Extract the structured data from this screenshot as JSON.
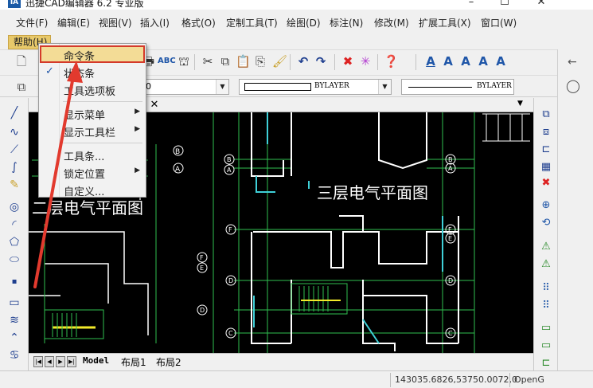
{
  "window": {
    "title": "迅捷CAD编辑器 6.2 专业版",
    "logo_text": "IA",
    "minimize_glyph": "–",
    "maximize_glyph": "☐",
    "close_glyph": "✕"
  },
  "menubar": {
    "items": [
      "文件(F)",
      "编辑(E)",
      "视图(V)",
      "插入(I)",
      "格式(O)",
      "定制工具(T)",
      "绘图(D)",
      "标注(N)",
      "修改(M)",
      "扩展工具(X)",
      "窗口(W)"
    ],
    "help_label": "帮助(H)"
  },
  "toolbar2": {
    "layer_value": "0",
    "linetype_value": "BYLAYER",
    "lineweight_value": "BYLAYER"
  },
  "help_menu": {
    "items": [
      {
        "label": "命令条",
        "checked": false,
        "submenu": false,
        "highlighted": true
      },
      {
        "label": "状态条",
        "checked": true,
        "submenu": false,
        "highlighted": false
      },
      {
        "label": "工具选项板",
        "checked": false,
        "submenu": false,
        "highlighted": false
      },
      {
        "label": "显示菜单",
        "checked": false,
        "submenu": true,
        "highlighted": false
      },
      {
        "label": "显示工具栏",
        "checked": false,
        "submenu": true,
        "highlighted": false
      },
      {
        "label": "工具条...",
        "checked": false,
        "submenu": false,
        "highlighted": false
      },
      {
        "label": "锁定位置",
        "checked": false,
        "submenu": true,
        "highlighted": false
      },
      {
        "label": "自定义...",
        "checked": false,
        "submenu": false,
        "highlighted": false
      }
    ],
    "check_glyph": "✓",
    "arrow_glyph": "▶"
  },
  "document": {
    "close_glyph": "✕"
  },
  "drawing": {
    "title_left": "二层电气平面图",
    "title_right": "三层电气平面图",
    "axis_labels_right": [
      "B",
      "A",
      "F",
      "E",
      "D",
      "C",
      "B",
      "A"
    ],
    "axis_labels_mid": [
      "F",
      "E",
      "D",
      "C"
    ]
  },
  "layout_tabs": {
    "tabs": [
      "Model",
      "布局1",
      "布局2"
    ],
    "nav_first": "|◀",
    "nav_prev": "◀",
    "nav_next": "▶",
    "nav_last": "▶|"
  },
  "status": {
    "coordinates": "143035.6826,53750.0072,0",
    "open_text": "OpenG"
  },
  "colors": {
    "highlight_border": "#d43a2a",
    "highlight_fill": "#f3dc96",
    "help_menu_bg": "#e8c96a",
    "canvas_bg": "#000000",
    "cad_green": "#2fbf4f",
    "cad_cyan": "#3fd0d8",
    "cad_yellow": "#f2ea2a",
    "arrow_red": "#e23a2e"
  }
}
